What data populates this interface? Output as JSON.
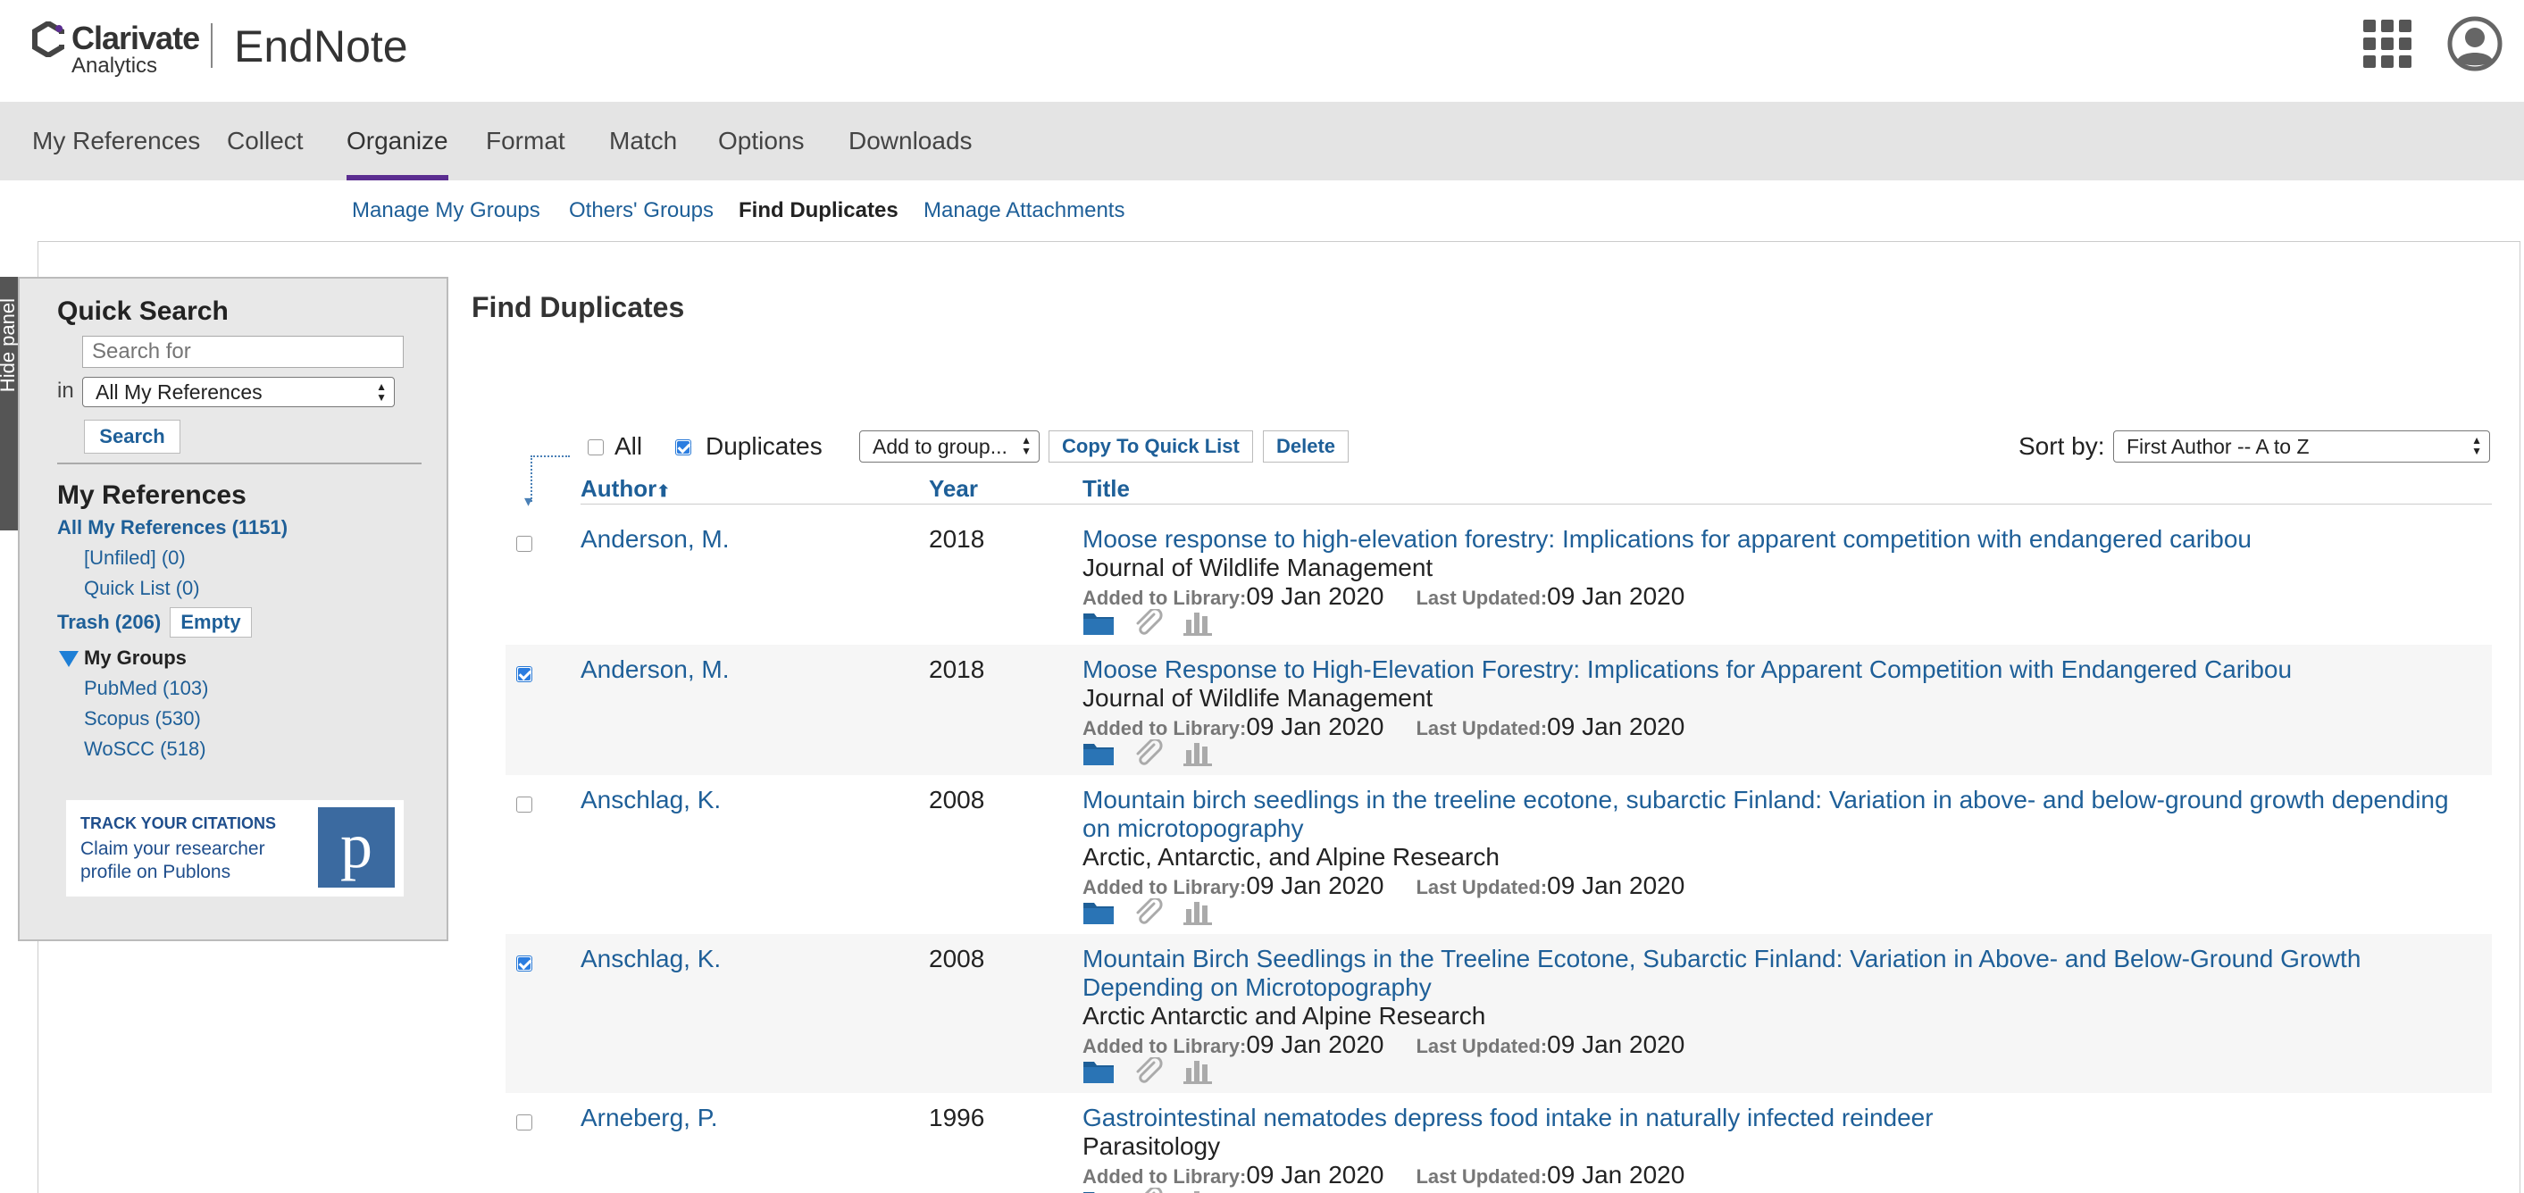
{
  "header": {
    "logo_word": "Clarivate",
    "logo_sub": "Analytics",
    "app_name": "EndNote",
    "apps_icon": "grid-icon",
    "user_icon": "avatar-icon"
  },
  "nav": {
    "items": [
      "My References",
      "Collect",
      "Organize",
      "Format",
      "Match",
      "Options",
      "Downloads"
    ],
    "active": "Organize",
    "accent_color": "#5b2d90"
  },
  "subnav": {
    "items": [
      "Manage My Groups",
      "Others' Groups",
      "Find Duplicates",
      "Manage Attachments"
    ],
    "active": "Find Duplicates"
  },
  "hide_panel_label": "Hide panel",
  "sidebar": {
    "quick_search_title": "Quick Search",
    "search_placeholder": "Search for",
    "in_label": "in",
    "scope_selected": "All My References",
    "search_button": "Search",
    "my_references_title": "My References",
    "all_refs": "All My References (1151)",
    "unfiled": "[Unfiled] (0)",
    "quick_list": "Quick List (0)",
    "trash": "Trash (206)",
    "empty_button": "Empty",
    "my_groups_title": "My Groups",
    "groups": [
      "PubMed (103)",
      "Scopus (530)",
      "WoSCC (518)"
    ],
    "promo": {
      "heading": "TRACK YOUR CITATIONS",
      "text": "Claim your researcher profile on Publons",
      "logo_letter": "p"
    }
  },
  "main": {
    "title": "Find Duplicates",
    "toolbar": {
      "all_label": "All",
      "all_checked": false,
      "duplicates_label": "Duplicates",
      "duplicates_checked": true,
      "add_to_group": "Add to group...",
      "copy_button": "Copy To Quick List",
      "delete_button": "Delete",
      "sort_label": "Sort by:",
      "sort_selected": "First Author -- A to Z"
    },
    "columns": {
      "author": "Author",
      "sort_arrow": "⬆",
      "year": "Year",
      "title": "Title"
    },
    "meta_labels": {
      "added": "Added to Library:",
      "updated": "Last Updated:"
    },
    "rows": [
      {
        "checked": false,
        "author": "Anderson, M.",
        "year": "2018",
        "title": "Moose response to high-elevation forestry: Implications for apparent competition with endangered caribou",
        "journal": "Journal of Wildlife Management",
        "added": "09 Jan 2020",
        "updated": "09 Jan 2020"
      },
      {
        "checked": true,
        "author": "Anderson, M.",
        "year": "2018",
        "title": "Moose Response to High-Elevation Forestry: Implications for Apparent Competition with Endangered Caribou",
        "journal": "Journal of Wildlife Management",
        "added": "09 Jan 2020",
        "updated": "09 Jan 2020"
      },
      {
        "checked": false,
        "author": "Anschlag, K.",
        "year": "2008",
        "title": "Mountain birch seedlings in the treeline ecotone, subarctic Finland: Variation in above- and below-ground growth depending on microtopography",
        "journal": "Arctic, Antarctic, and Alpine Research",
        "added": "09 Jan 2020",
        "updated": "09 Jan 2020"
      },
      {
        "checked": true,
        "author": "Anschlag, K.",
        "year": "2008",
        "title": "Mountain Birch Seedlings in the Treeline Ecotone, Subarctic Finland: Variation in Above- and Below-Ground Growth Depending on Microtopography",
        "journal": "Arctic Antarctic and Alpine Research",
        "added": "09 Jan 2020",
        "updated": "09 Jan 2020"
      },
      {
        "checked": false,
        "author": "Arneberg, P.",
        "year": "1996",
        "title": "Gastrointestinal nematodes depress food intake in naturally infected reindeer",
        "journal": "Parasitology",
        "added": "09 Jan 2020",
        "updated": "09 Jan 2020"
      }
    ],
    "row_icons": [
      "folder-icon",
      "paperclip-icon",
      "bar-chart-icon"
    ]
  }
}
